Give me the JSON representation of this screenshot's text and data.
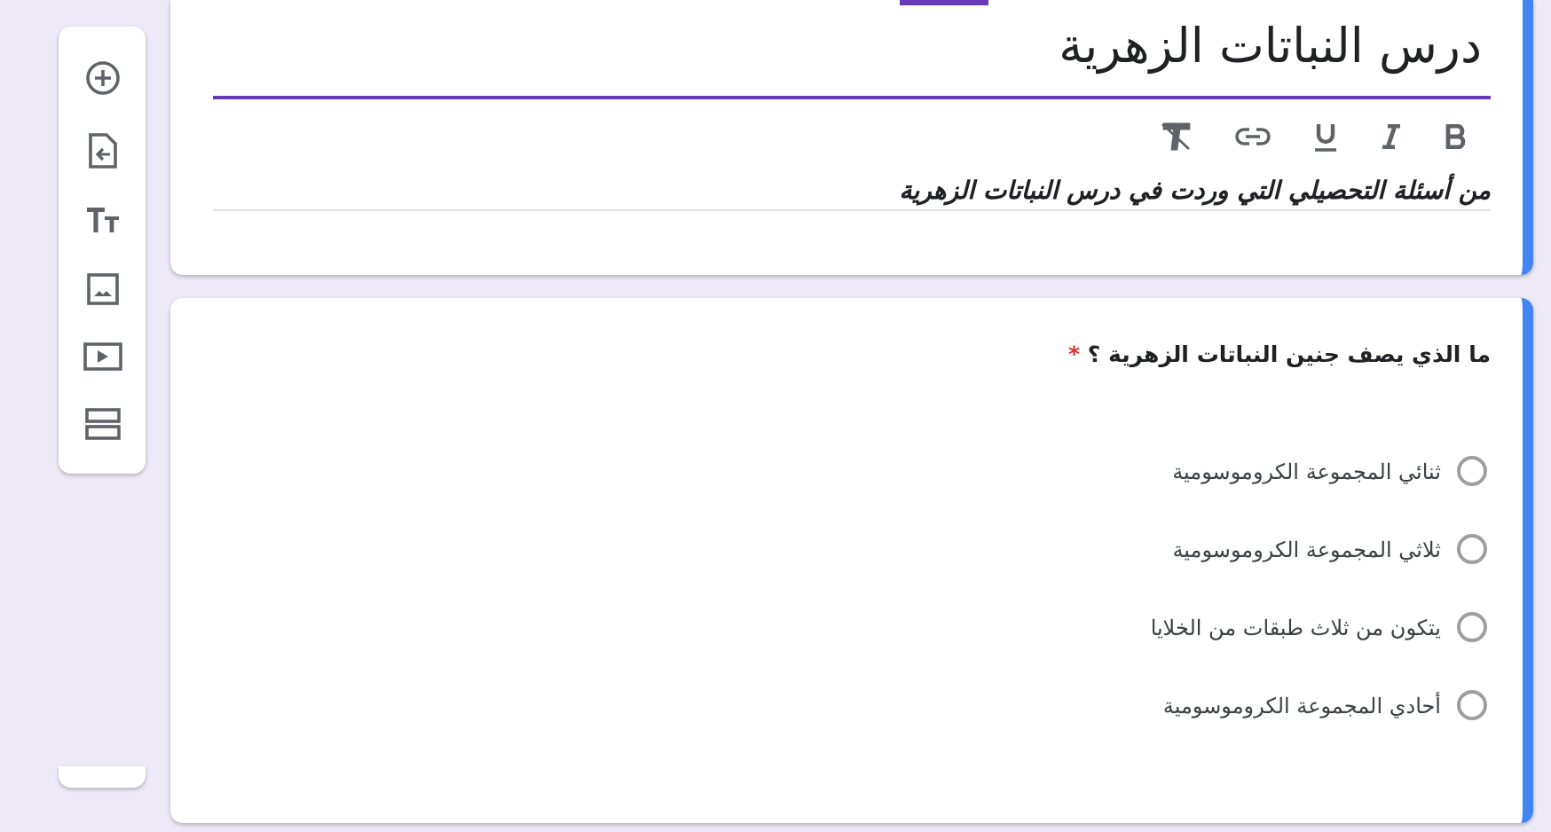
{
  "form": {
    "title": "درس النباتات الزهرية",
    "description": "من أسئلة التحصيلي التي وردت في درس النباتات الزهرية"
  },
  "question": {
    "text": "ما الذي يصف جنين النباتات الزهرية ؟",
    "required_mark": "*",
    "options": [
      {
        "label": "ثنائي المجموعة الكروموسومية",
        "selected": false
      },
      {
        "label": "ثلاثي المجموعة الكروموسومية",
        "selected": false
      },
      {
        "label": "يتكون من ثلاث طبقات من الخلايا",
        "selected": false
      },
      {
        "label": "أحادي المجموعة الكروموسومية",
        "selected": false
      }
    ]
  }
}
